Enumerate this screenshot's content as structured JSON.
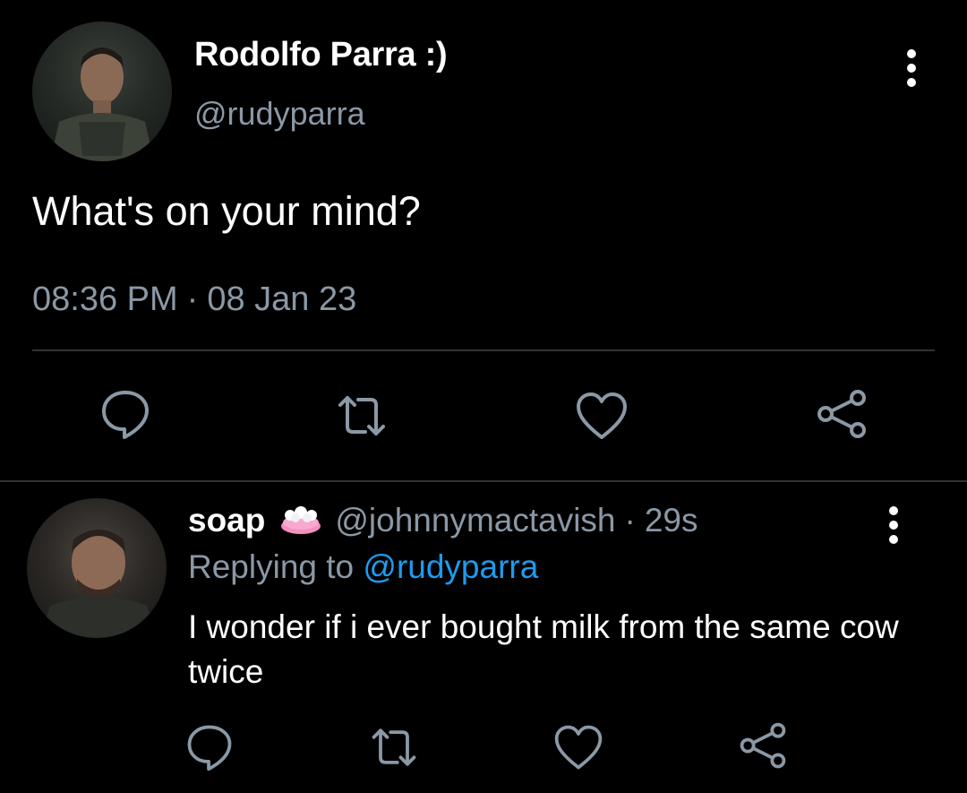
{
  "main_tweet": {
    "display_name": "Rodolfo Parra :)",
    "handle": "@rudyparra",
    "text": "What's on your mind?",
    "time": "08:36 PM",
    "separator": "·",
    "date": "08 Jan 23",
    "avatar_icon": "profile-photo",
    "menu_icon": "more-vertical-icon"
  },
  "actions": {
    "reply_icon": "reply-icon",
    "retweet_icon": "retweet-icon",
    "like_icon": "heart-icon",
    "share_icon": "share-icon"
  },
  "reply": {
    "display_name": "soap",
    "name_emoji": "soap-emoji",
    "handle": "@johnnymactavish",
    "separator": "·",
    "time": "29s",
    "replying_prefix": "Replying to",
    "replying_to": "@rudyparra",
    "text": "I wonder if i ever bought milk from the same cow twice"
  },
  "colors": {
    "background": "#000000",
    "primary_text": "#ffffff",
    "secondary_text": "#8b98a5",
    "link": "#1d9bf0",
    "divider": "#2f3336"
  }
}
